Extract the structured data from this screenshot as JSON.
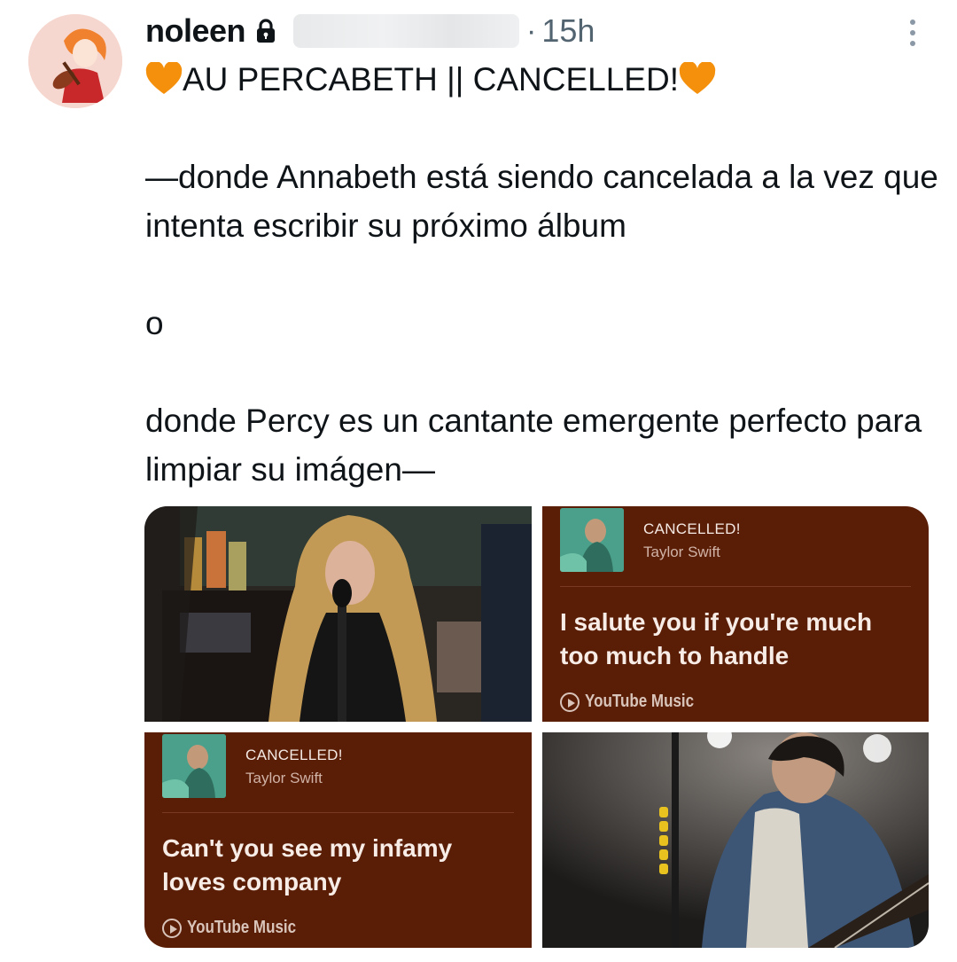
{
  "author": {
    "name": "noleen",
    "separator": "·",
    "time": "15h"
  },
  "tweet": {
    "title": "AU PERCABETH || CANCELLED!",
    "body": "\n\n—donde Annabeth está siendo cancelada a la vez que intenta escribir su próximo álbum\n\no\n\ndonde Percy es un cantante emergente perfecto para limpiar su imágen—"
  },
  "icons": {
    "lock": "lock-icon",
    "more": "more-vertical-icon",
    "heart": "orange-heart-icon",
    "youtube_music": "youtube-music-play-icon"
  },
  "colors": {
    "card_bg": "#5a1d06",
    "heart": "#f4900c",
    "secondary_text": "#536471"
  },
  "media": {
    "card_top": {
      "song": "CANCELLED!",
      "artist": "Taylor Swift",
      "lyric": "I salute you if you're much too much to handle",
      "source": "YouTube Music"
    },
    "card_bottom": {
      "song": "CANCELLED!",
      "artist": "Taylor Swift",
      "lyric": "Can't you see my infamy loves company",
      "source": "YouTube Music"
    }
  }
}
